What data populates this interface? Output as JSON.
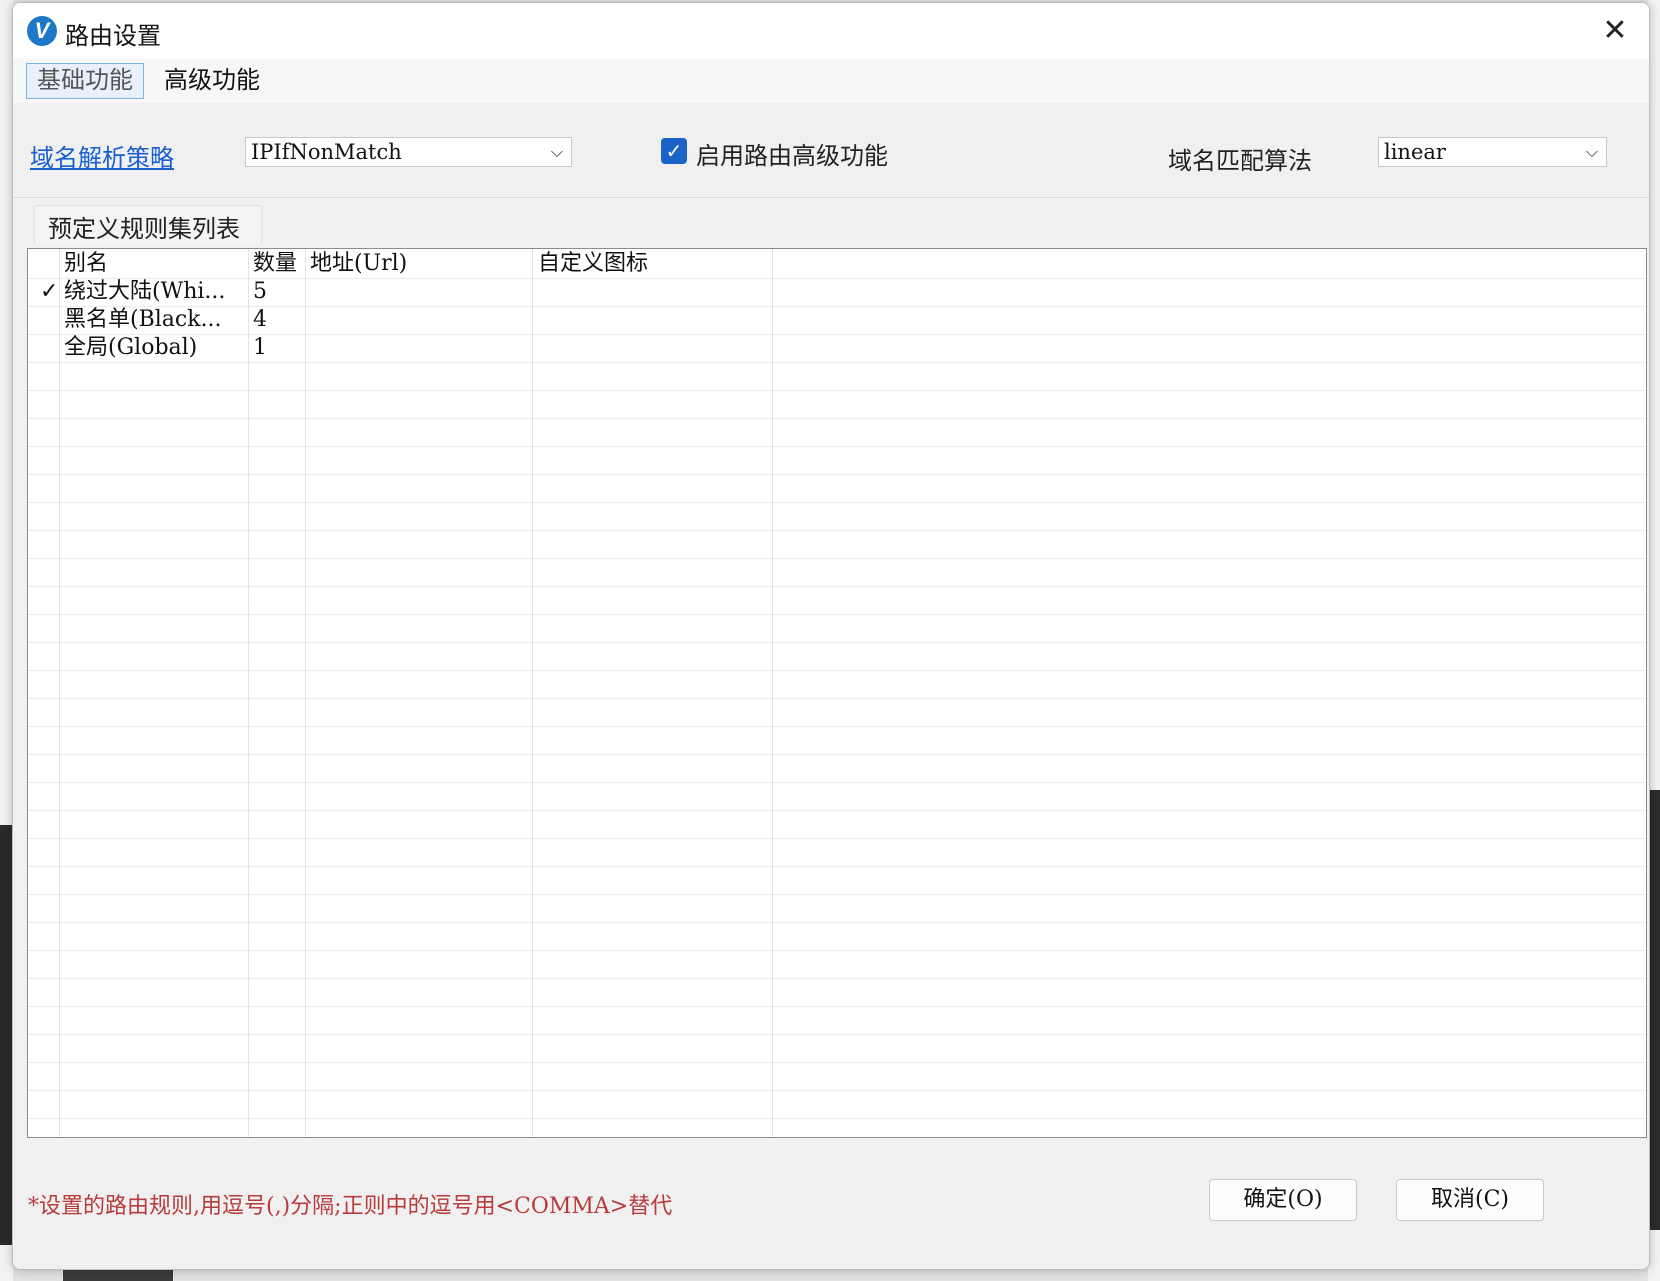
{
  "dialog": {
    "title": "路由设置",
    "app_icon": "v-logo-icon",
    "accent": "#1b63c6"
  },
  "tabs": [
    {
      "label": "基础功能",
      "active": true
    },
    {
      "label": "高级功能",
      "active": false
    }
  ],
  "settings": {
    "dns_strategy_label": "域名解析策略",
    "dns_strategy_value": "IPIfNonMatch",
    "enable_advanced_label": "启用路由高级功能",
    "enable_advanced_checked": true,
    "match_algorithm_label": "域名匹配算法",
    "match_algorithm_value": "linear"
  },
  "rules_section": {
    "title": "预定义规则集列表",
    "columns": [
      "别名",
      "数量",
      "地址(Url)",
      "自定义图标"
    ],
    "rows": [
      {
        "selected": true,
        "check": "✓",
        "alias": "绕过大陆(Whi...",
        "count": "5",
        "url": "",
        "icon": ""
      },
      {
        "selected": false,
        "check": "",
        "alias": "黑名单(Black...",
        "count": "4",
        "url": "",
        "icon": ""
      },
      {
        "selected": false,
        "check": "",
        "alias": "全局(Global)",
        "count": "1",
        "url": "",
        "icon": ""
      }
    ]
  },
  "footer": {
    "note": "*设置的路由规则,用逗号(,)分隔;正则中的逗号用<COMMA>替代",
    "ok_label": "确定(O)",
    "cancel_label": "取消(C)"
  },
  "colors": {
    "link": "#1a5fd0",
    "note": "#b83b3b",
    "checkbox": "#1b63c6"
  }
}
